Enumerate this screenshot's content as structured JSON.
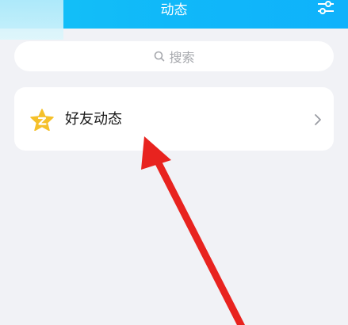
{
  "header": {
    "title": "动态"
  },
  "search": {
    "label": "搜索"
  },
  "friend_feed": {
    "label": "好友动态"
  },
  "icons": {
    "filter": "filter-settings-icon",
    "search": "search-icon",
    "star": "qzone-star-icon",
    "chevron": "chevron-right-icon"
  },
  "colors": {
    "header": "#12baf8",
    "background": "#f1f2f6",
    "star": "#f5c02a",
    "arrow": "#e8231f"
  }
}
